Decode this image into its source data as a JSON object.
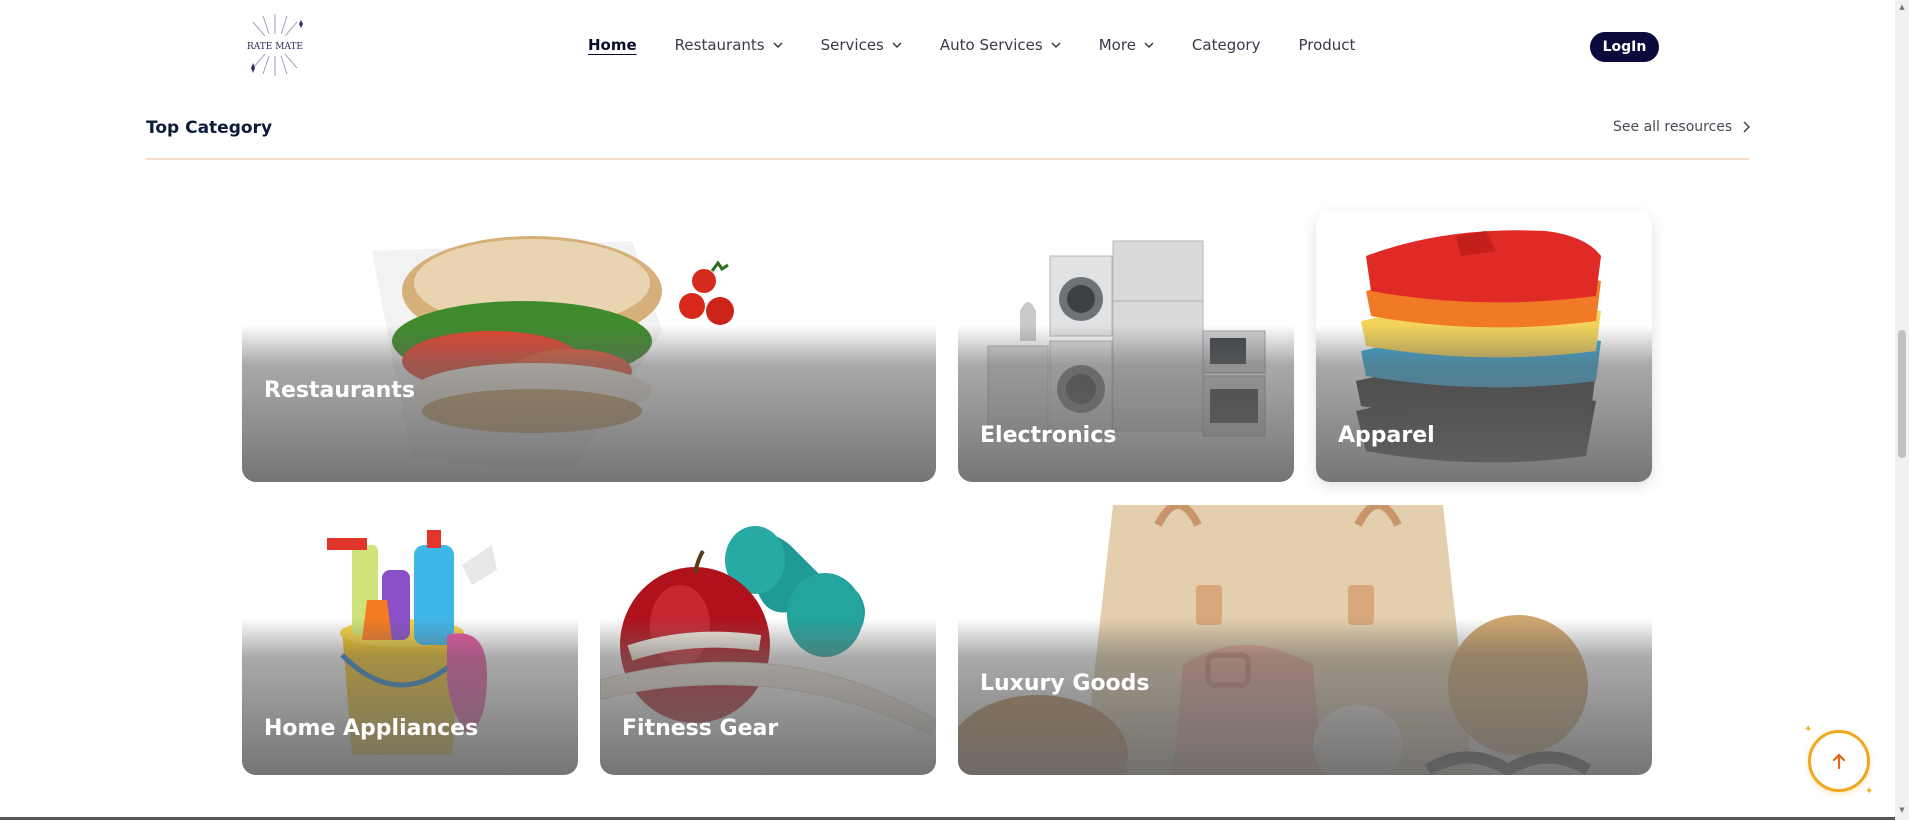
{
  "header": {
    "logo_text": "RATE MATE",
    "nav": [
      {
        "label": "Home",
        "active": true,
        "dropdown": false
      },
      {
        "label": "Restaurants",
        "active": false,
        "dropdown": true
      },
      {
        "label": "Services",
        "active": false,
        "dropdown": true
      },
      {
        "label": "Auto Services",
        "active": false,
        "dropdown": true
      },
      {
        "label": "More",
        "active": false,
        "dropdown": true
      },
      {
        "label": "Category",
        "active": false,
        "dropdown": false
      },
      {
        "label": "Product",
        "active": false,
        "dropdown": false
      }
    ],
    "login_label": "LogIn"
  },
  "section": {
    "title": "Top Category",
    "see_all_label": "See all resources"
  },
  "categories": [
    {
      "label": "Restaurants",
      "icon": "sandwich-image"
    },
    {
      "label": "Electronics",
      "icon": "appliances-image"
    },
    {
      "label": "Apparel",
      "icon": "folded-shirts-image"
    },
    {
      "label": "Home Appliances",
      "icon": "cleaning-bucket-image"
    },
    {
      "label": "Fitness Gear",
      "icon": "apple-dumbbells-image"
    },
    {
      "label": "Luxury Goods",
      "icon": "handbags-image"
    }
  ],
  "colors": {
    "brand_navy": "#0a0a3c",
    "accent_orange": "#f2a81d",
    "divider": "#f3dcc9"
  }
}
